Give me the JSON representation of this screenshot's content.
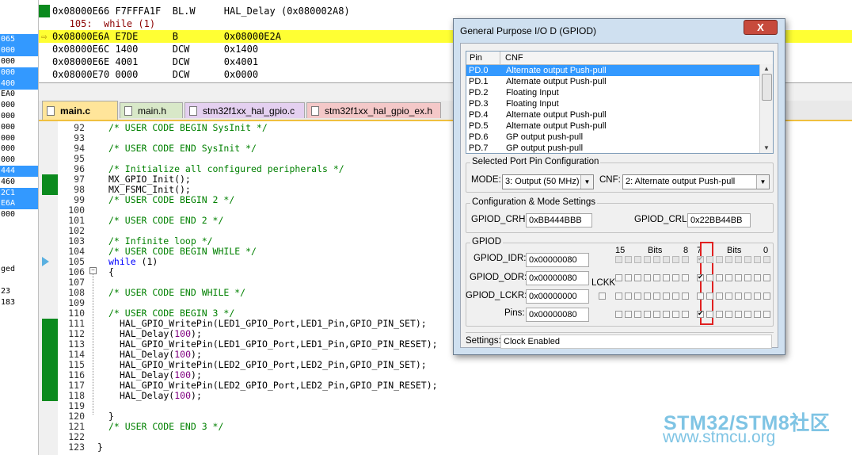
{
  "left_strip": [
    {
      "text": "",
      "sel": false
    },
    {
      "text": "",
      "sel": false
    },
    {
      "text": "",
      "sel": false
    },
    {
      "text": "065",
      "sel": true
    },
    {
      "text": "000",
      "sel": true
    },
    {
      "text": "000",
      "sel": false
    },
    {
      "text": "000",
      "sel": true
    },
    {
      "text": "400",
      "sel": true
    },
    {
      "text": "EA0",
      "sel": false
    },
    {
      "text": "000",
      "sel": false
    },
    {
      "text": "000",
      "sel": false
    },
    {
      "text": "000",
      "sel": false
    },
    {
      "text": "000",
      "sel": false
    },
    {
      "text": "000",
      "sel": false
    },
    {
      "text": "000",
      "sel": false
    },
    {
      "text": "444",
      "sel": true
    },
    {
      "text": "460",
      "sel": false
    },
    {
      "text": "2C1",
      "sel": true
    },
    {
      "text": "E6A",
      "sel": true
    },
    {
      "text": "000",
      "sel": false
    },
    {
      "text": "",
      "sel": false
    },
    {
      "text": "",
      "sel": false
    },
    {
      "text": "",
      "sel": false
    },
    {
      "text": "",
      "sel": false
    },
    {
      "text": "ged",
      "sel": false
    },
    {
      "text": "",
      "sel": false
    },
    {
      "text": "23",
      "sel": false
    },
    {
      "text": "183",
      "sel": false
    }
  ],
  "disasm": [
    {
      "text": "0x08000E66 F7FFFA1F  BL.W     HAL_Delay (0x080002A8)",
      "gutter": true,
      "hl": false,
      "src": false
    },
    {
      "text": "   105:  while (1)",
      "gutter": false,
      "hl": false,
      "src": true
    },
    {
      "text": "0x08000E6A E7DE      B        0x08000E2A",
      "gutter": false,
      "hl": true,
      "src": false
    },
    {
      "text": "0x08000E6C 1400      DCW      0x1400",
      "gutter": false,
      "hl": false,
      "src": false
    },
    {
      "text": "0x08000E6E 4001      DCW      0x4001",
      "gutter": false,
      "hl": false,
      "src": false
    },
    {
      "text": "0x08000E70 0000      DCW      0x0000",
      "gutter": false,
      "hl": false,
      "src": false
    }
  ],
  "tabs": [
    {
      "label": "main.c",
      "active": true,
      "color": "#ffe59a"
    },
    {
      "label": "main.h",
      "active": false,
      "color": "#d8e8c8"
    },
    {
      "label": "stm32f1xx_hal_gpio.c",
      "active": false,
      "color": "#e4d0f0"
    },
    {
      "label": "stm32f1xx_hal_gpio_ex.h",
      "active": false,
      "color": "#f4c8c8"
    }
  ],
  "code": [
    {
      "ln": "92",
      "text": "/* USER CODE BEGIN SysInit */",
      "indent": 0,
      "kind": "cmt"
    },
    {
      "ln": "93",
      "text": "",
      "indent": 0,
      "kind": "plain"
    },
    {
      "ln": "94",
      "text": "/* USER CODE END SysInit */",
      "indent": 0,
      "kind": "cmt"
    },
    {
      "ln": "95",
      "text": "",
      "indent": 0,
      "kind": "plain"
    },
    {
      "ln": "96",
      "text": "/* Initialize all configured peripherals */",
      "indent": 0,
      "kind": "cmt"
    },
    {
      "ln": "97",
      "text": "MX_GPIO_Init();",
      "indent": 0,
      "kind": "plain"
    },
    {
      "ln": "98",
      "text": "MX_FSMC_Init();",
      "indent": 0,
      "kind": "plain"
    },
    {
      "ln": "99",
      "text": "/* USER CODE BEGIN 2 */",
      "indent": 0,
      "kind": "cmt"
    },
    {
      "ln": "100",
      "text": "",
      "indent": 0,
      "kind": "plain"
    },
    {
      "ln": "101",
      "text": "/* USER CODE END 2 */",
      "indent": 0,
      "kind": "cmt"
    },
    {
      "ln": "102",
      "text": "",
      "indent": 0,
      "kind": "plain"
    },
    {
      "ln": "103",
      "text": "/* Infinite loop */",
      "indent": 0,
      "kind": "cmt"
    },
    {
      "ln": "104",
      "text": "/* USER CODE BEGIN WHILE */",
      "indent": 0,
      "kind": "cmt"
    },
    {
      "ln": "105",
      "text": "while (1)",
      "indent": 0,
      "kind": "kw"
    },
    {
      "ln": "106",
      "text": "{",
      "indent": 0,
      "kind": "plain"
    },
    {
      "ln": "107",
      "text": "",
      "indent": 0,
      "kind": "plain"
    },
    {
      "ln": "108",
      "text": "/* USER CODE END WHILE */",
      "indent": 0,
      "kind": "cmt"
    },
    {
      "ln": "109",
      "text": "",
      "indent": 0,
      "kind": "plain"
    },
    {
      "ln": "110",
      "text": "/* USER CODE BEGIN 3 */",
      "indent": 0,
      "kind": "cmt"
    },
    {
      "ln": "111",
      "text": "HAL_GPIO_WritePin(LED1_GPIO_Port,LED1_Pin,GPIO_PIN_SET);",
      "indent": 1,
      "kind": "plain"
    },
    {
      "ln": "112",
      "text": "HAL_Delay(100);",
      "indent": 1,
      "kind": "num"
    },
    {
      "ln": "113",
      "text": "HAL_GPIO_WritePin(LED1_GPIO_Port,LED1_Pin,GPIO_PIN_RESET);",
      "indent": 1,
      "kind": "plain"
    },
    {
      "ln": "114",
      "text": "HAL_Delay(100);",
      "indent": 1,
      "kind": "num"
    },
    {
      "ln": "115",
      "text": "HAL_GPIO_WritePin(LED2_GPIO_Port,LED2_Pin,GPIO_PIN_SET);",
      "indent": 1,
      "kind": "plain"
    },
    {
      "ln": "116",
      "text": "HAL_Delay(100);",
      "indent": 1,
      "kind": "num"
    },
    {
      "ln": "117",
      "text": "HAL_GPIO_WritePin(LED2_GPIO_Port,LED2_Pin,GPIO_PIN_RESET);",
      "indent": 1,
      "kind": "plain"
    },
    {
      "ln": "118",
      "text": "HAL_Delay(100);",
      "indent": 1,
      "kind": "num"
    },
    {
      "ln": "119",
      "text": "",
      "indent": 0,
      "kind": "plain"
    },
    {
      "ln": "120",
      "text": "}",
      "indent": 0,
      "kind": "plain"
    },
    {
      "ln": "121",
      "text": "/* USER CODE END 3 */",
      "indent": 0,
      "kind": "cmt"
    },
    {
      "ln": "122",
      "text": "",
      "indent": 0,
      "kind": "plain"
    },
    {
      "ln": "123",
      "text": "}",
      "indent": -1,
      "kind": "plain"
    }
  ],
  "green_marks": [
    "97",
    "98",
    "111",
    "112",
    "113",
    "114",
    "115",
    "116",
    "117",
    "118"
  ],
  "current_line": "105",
  "dialog": {
    "title": "General Purpose I/O D (GPIOD)",
    "close_label": "X",
    "pin_header": "Pin",
    "cnf_header": "CNF",
    "pins": [
      {
        "pin": "PD.0",
        "cnf": "Alternate output Push-pull",
        "selected": true
      },
      {
        "pin": "PD.1",
        "cnf": "Alternate output Push-pull",
        "selected": false
      },
      {
        "pin": "PD.2",
        "cnf": "Floating Input",
        "selected": false
      },
      {
        "pin": "PD.3",
        "cnf": "Floating Input",
        "selected": false
      },
      {
        "pin": "PD.4",
        "cnf": "Alternate output Push-pull",
        "selected": false
      },
      {
        "pin": "PD.5",
        "cnf": "Alternate output Push-pull",
        "selected": false
      },
      {
        "pin": "PD.6",
        "cnf": "GP output push-pull",
        "selected": false
      },
      {
        "pin": "PD.7",
        "cnf": "GP output push-pull",
        "selected": false
      }
    ],
    "port_config_title": "Selected Port Pin Configuration",
    "mode_label": "MODE:",
    "mode_value": "3: Output (50 MHz)",
    "cnf_label": "CNF:",
    "cnf_value": "2: Alternate output Push-pull",
    "config_title": "Configuration & Mode Settings",
    "crh_label": "GPIOD_CRH:",
    "crh_value": "0xBB444BBB",
    "crl_label": "GPIOD_CRL:",
    "crl_value": "0x22BB44BB",
    "gpiod_title": "GPIOD",
    "bits_high": "15",
    "bits_label1": "Bits",
    "bits_8": "8",
    "bits_7": "7",
    "bits_label2": "Bits",
    "bits_0": "0",
    "idr_label": "GPIOD_IDR:",
    "idr_value": "0x00000080",
    "odr_label": "GPIOD_ODR:",
    "odr_value": "0x00000080",
    "lckk_label": "LCKK",
    "lckr_label": "GPIOD_LCKR:",
    "lckr_value": "0x00000000",
    "pins_label": "Pins:",
    "pins_value": "0x00000080",
    "settings_label": "Settings:",
    "settings_value": "Clock Enabled"
  },
  "watermark": {
    "line1_a": "STM32",
    "line1_sep": "/",
    "line1_b": "STM8社区",
    "line2": "www.stmcu.org"
  },
  "colors": {
    "highlight": "#ffff33",
    "gutter_green": "#0b8a1e",
    "selection": "#3399ff",
    "redbox": "#e02020",
    "watermark": "#7fc4e4"
  }
}
